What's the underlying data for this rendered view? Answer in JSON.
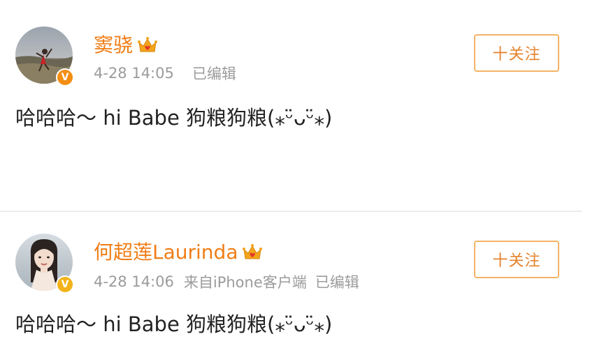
{
  "colors": {
    "username": "#f07d16",
    "meta": "#9b9b9b",
    "follow_border": "#f4b366",
    "follow_text": "#e6822b",
    "verified_badge": "#f38e13",
    "verified_badge_alt": "#f2b31a"
  },
  "posts": [
    {
      "username": "窦骁",
      "user_badge_icon": "vip-crown-icon",
      "verified_icon": "verified-v-icon",
      "time": "4-28 14:05",
      "source": "",
      "edited": "已编辑",
      "follow_label": "十关注",
      "text": "哈哈哈～ hi Babe 狗粮狗粮(⁎ᵕ̈ᴗᵕ̈⁎)"
    },
    {
      "username": "何超莲Laurinda",
      "user_badge_icon": "vip-crown-icon",
      "verified_icon": "verified-v-icon",
      "time": "4-28 14:06",
      "source": "来自iPhone客户端",
      "edited": "已编辑",
      "follow_label": "十关注",
      "text": "哈哈哈～ hi Babe 狗粮狗粮(⁎ᵕ̈ᴗᵕ̈⁎)"
    }
  ]
}
